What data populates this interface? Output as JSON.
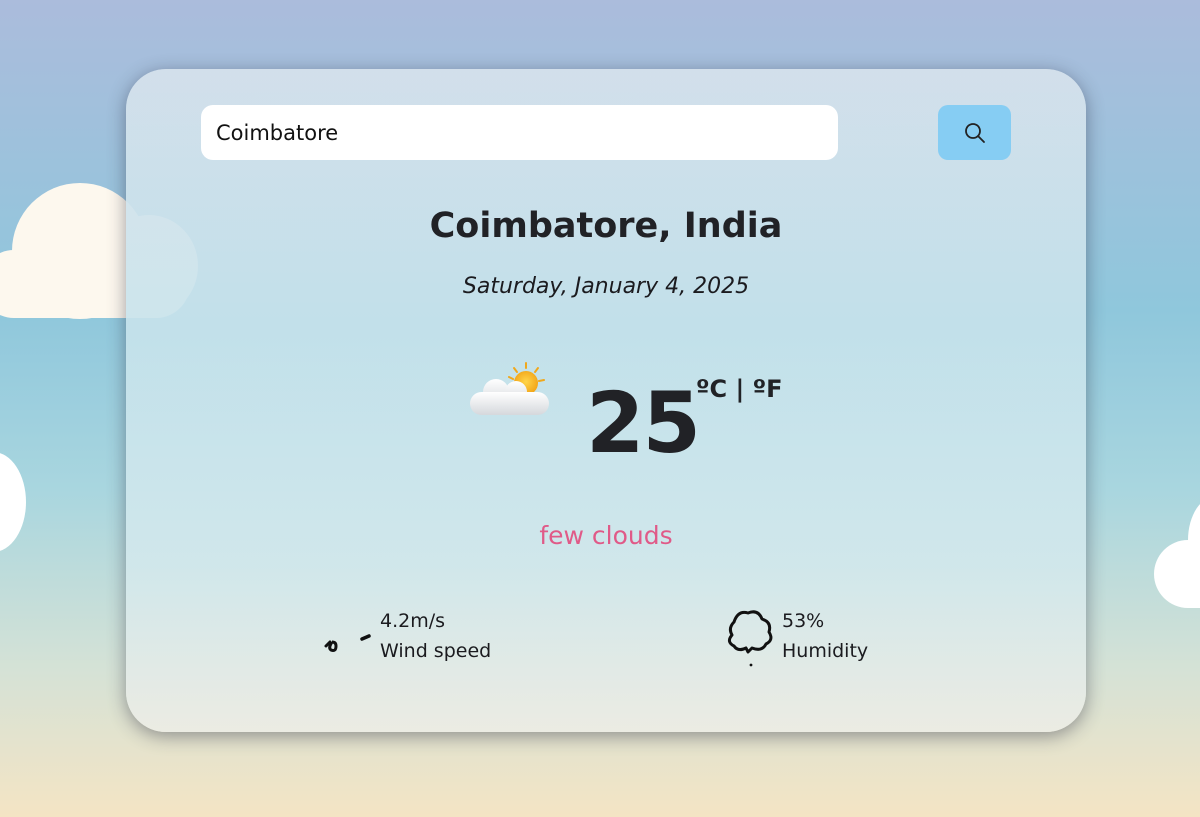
{
  "search": {
    "value": "Coimbatore",
    "icon": "search-icon"
  },
  "location": {
    "title": "Coimbatore, India",
    "date": "Saturday, January 4, 2025"
  },
  "current": {
    "icon": "partly-cloudy-icon",
    "temperature": "25",
    "unit_c": "ºC",
    "unit_separator": " | ",
    "unit_f": "ºF",
    "description": "few clouds"
  },
  "stats": {
    "wind": {
      "icon": "wind-icon",
      "value": "4.2m/s",
      "label": "Wind speed"
    },
    "humidity": {
      "icon": "humidity-icon",
      "value": "53%",
      "label": "Humidity"
    }
  },
  "colors": {
    "search_button": "#86cdf3",
    "description": "#e05a88",
    "text_dark": "#212226"
  }
}
